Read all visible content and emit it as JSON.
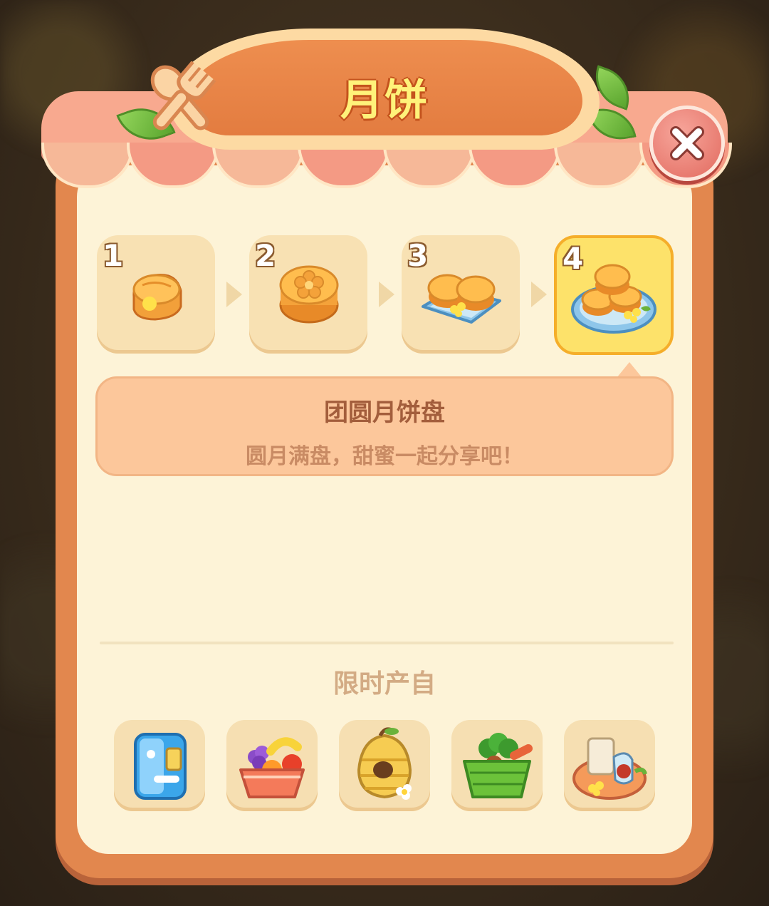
{
  "header": {
    "title": "月饼",
    "icon": "fork-spoon-icon",
    "close_icon": "close-icon"
  },
  "chain": {
    "items": [
      {
        "level": "1",
        "icon": "mooncake-slice-icon"
      },
      {
        "level": "2",
        "icon": "mooncake-icon"
      },
      {
        "level": "3",
        "icon": "mooncake-plate-icon"
      },
      {
        "level": "4",
        "icon": "mooncake-platter-icon",
        "selected": true
      }
    ]
  },
  "detail": {
    "name": "团圆月饼盘",
    "description": "圆月满盘，甜蜜一起分享吧！"
  },
  "sources": {
    "title": "限时产自",
    "items": [
      {
        "icon": "blue-fridge-icon"
      },
      {
        "icon": "fruit-basket-icon"
      },
      {
        "icon": "beehive-icon"
      },
      {
        "icon": "vegetable-basket-icon"
      },
      {
        "icon": "picnic-basket-icon"
      }
    ]
  },
  "colors": {
    "panel_border": "#e2874e",
    "panel_fill": "#fdf3d7",
    "title_text": "#fff27a",
    "selected_card": "#fde26a",
    "detail_box": "#fcc79b"
  }
}
